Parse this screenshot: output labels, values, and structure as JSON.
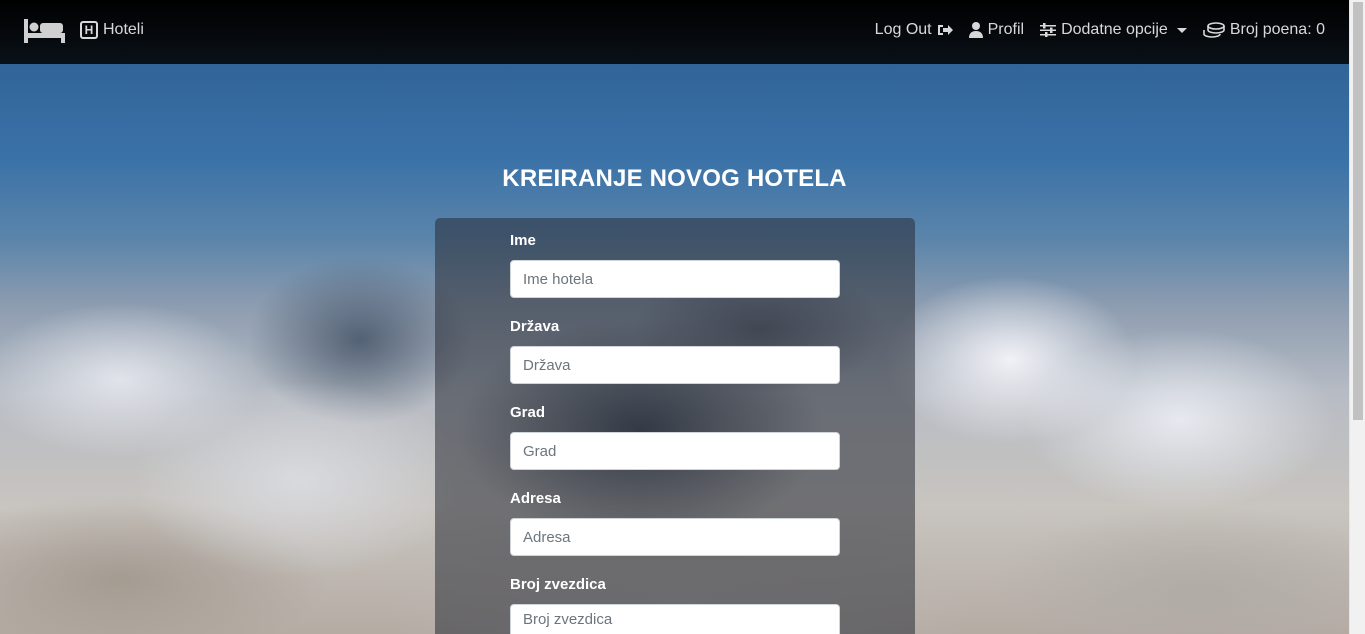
{
  "nav": {
    "brand_icon": "bed-icon",
    "hotels_label": "Hoteli",
    "logout_label": "Log Out",
    "profile_label": "Profil",
    "options_label": "Dodatne opcije",
    "points_label": "Broj poena: 0"
  },
  "page": {
    "title": "KREIRANJE NOVOG HOTELA"
  },
  "form": {
    "fields": [
      {
        "label": "Ime",
        "placeholder": "Ime hotela"
      },
      {
        "label": "Država",
        "placeholder": "Država"
      },
      {
        "label": "Grad",
        "placeholder": "Grad"
      },
      {
        "label": "Adresa",
        "placeholder": "Adresa"
      },
      {
        "label": "Broj zvezdica",
        "placeholder": "Broj zvezdica"
      }
    ]
  },
  "colors": {
    "navbar": "#000000",
    "title": "#ffffff"
  }
}
